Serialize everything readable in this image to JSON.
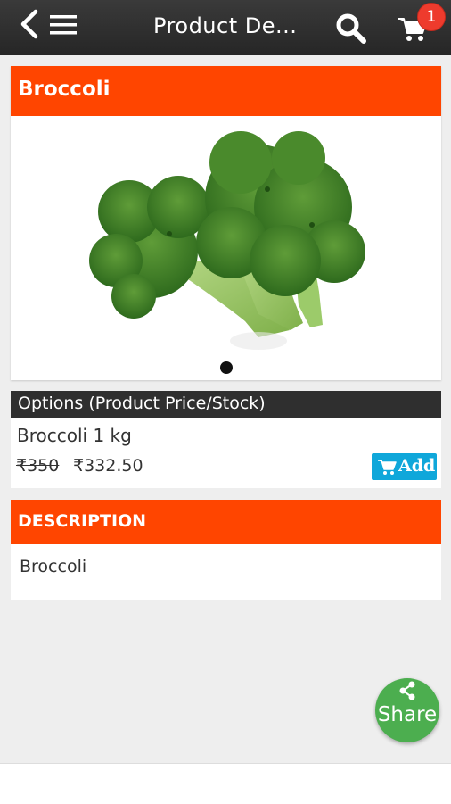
{
  "header": {
    "title": "Product De...",
    "cart_count": "1",
    "icons": [
      "back-icon",
      "menu-icon",
      "search-icon",
      "cart-icon"
    ]
  },
  "product": {
    "name": "Broccoli",
    "image": "broccoli-image"
  },
  "options": {
    "title": "Options (Product Price/Stock)",
    "variant": "Broccoli 1 kg",
    "old_price": "₹350",
    "new_price": "₹332.50",
    "add_label": "Add"
  },
  "description": {
    "title": "DESCRIPTION",
    "text": "Broccoli"
  },
  "share": {
    "label": "Share"
  },
  "colors": {
    "accent": "#ff4500",
    "topbar": "#2b2b2b",
    "add_button": "#0fa7da",
    "share_button": "#4cae4f",
    "badge": "#ee3b2d"
  }
}
